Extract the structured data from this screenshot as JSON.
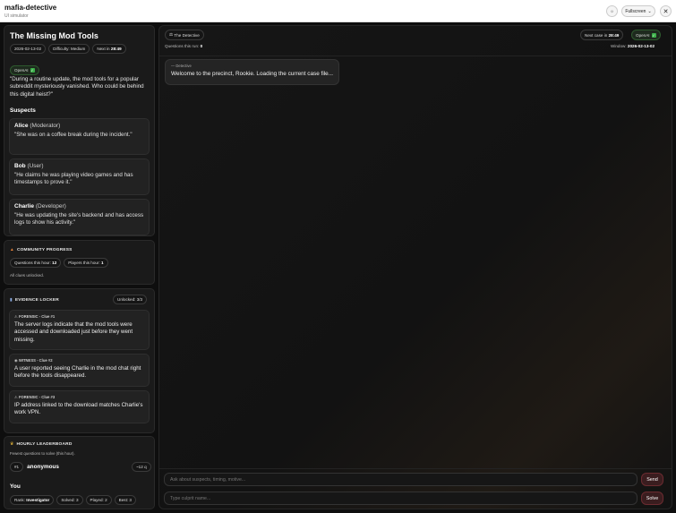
{
  "app": {
    "title": "mafia-detective",
    "subtitle": "UI simulator",
    "fullscreen_label": "Fullscreen"
  },
  "case": {
    "title": "The Missing Mod Tools",
    "date": "2026-02-13-02",
    "difficulty": "Difficulty: Medium",
    "next_prefix": "Next in",
    "next_time": "28:49",
    "provider": "OpenAI",
    "description": "\"During a routine update, the mod tools for a popular subreddit mysteriously vanished. Who could be behind this digital heist?\"",
    "suspects_label": "Suspects",
    "suspects": [
      {
        "name": "Alice",
        "role": "(Moderator)",
        "quote": "\"She was on a coffee break during the incident.\""
      },
      {
        "name": "Bob",
        "role": "(User)",
        "quote": "\"He claims he was playing video games and has timestamps to prove it.\""
      },
      {
        "name": "Charlie",
        "role": "(Developer)",
        "quote": "\"He was updating the site's backend and has access logs to show his activity.\""
      }
    ]
  },
  "community": {
    "title": "COMMUNITY PROGRESS",
    "questions_label": "Questions this hour:",
    "questions_value": "12",
    "players_label": "Players this hour:",
    "players_value": "1",
    "note": "All clues unlocked."
  },
  "evidence": {
    "title": "EVIDENCE LOCKER",
    "unlocked": "Unlocked: 3/3",
    "clues": [
      {
        "header": "FORENSIC - Clue #1",
        "text": "The server logs indicate that the mod tools were accessed and downloaded just before they went missing."
      },
      {
        "header": "WITNESS - Clue #2",
        "text": "A user reported seeing Charlie in the mod chat right before the tools disappeared."
      },
      {
        "header": "FORENSIC - Clue #3",
        "text": "IP address linked to the download matches Charlie's work VPN."
      }
    ]
  },
  "leaderboard": {
    "title": "HOURLY LEADERBOARD",
    "subtitle": "Fewest questions to solve (this hour).",
    "rank": "#1",
    "player": "anonymous",
    "score": "~12 q",
    "you_label": "You",
    "rank_label": "Rank:",
    "rank_value": "Investigator",
    "solved": "Solved: 3",
    "played": "Played: 2",
    "best": "Best: 3"
  },
  "chat": {
    "tab_label": "The Detective",
    "questions_run_label": "Questions this run:",
    "questions_run_value": "0",
    "next_case_label": "Next case in",
    "next_case_time": "28:49",
    "provider": "OpenAI",
    "window_label": "Window:",
    "window_value": "2026-02-13-02",
    "message_author": "Detective",
    "message_text": "Welcome to the precinct, Rookie. Loading the current case file...",
    "ask_placeholder": "Ask about suspects, timing, motive...",
    "send_label": "Send",
    "culprit_placeholder": "Type culprit name...",
    "solve_label": "Solve"
  },
  "colors": {
    "background": "#0e0e0e",
    "card": "#1a1a1a",
    "accent_button": "#3a1d1f",
    "openai_check": "#3db04a"
  }
}
